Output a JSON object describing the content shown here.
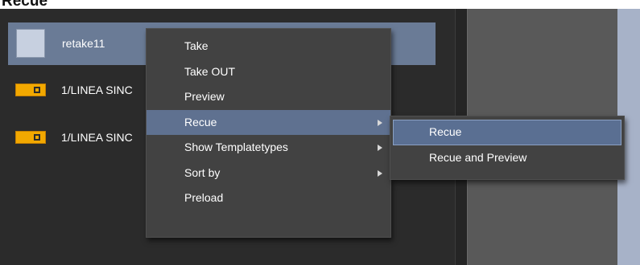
{
  "window": {
    "heading": "Recue"
  },
  "list": {
    "items": [
      {
        "label": "retake11",
        "icon": "template-thumbnail-icon"
      },
      {
        "label": "1/LINEA SINC",
        "icon": "toggle-icon"
      },
      {
        "label": "1/LINEA SINC",
        "icon": "toggle-icon"
      }
    ]
  },
  "context_menu": {
    "items": [
      {
        "label": "Take"
      },
      {
        "label": "Take OUT"
      },
      {
        "label": "Preview"
      },
      {
        "label": "Recue",
        "submenu": true,
        "highlighted": true
      },
      {
        "label": "Show Templatetypes",
        "submenu": true
      },
      {
        "label": "Sort by",
        "submenu": true
      },
      {
        "label": "Preload"
      }
    ],
    "submenu_items": [
      {
        "label": "Recue",
        "highlighted": true
      },
      {
        "label": "Recue and Preview"
      }
    ]
  },
  "colors": {
    "highlight": "#5f7190",
    "toggle_icon": "#f2a800",
    "panel_bg": "#2b2b2b",
    "menu_bg": "#424242"
  }
}
